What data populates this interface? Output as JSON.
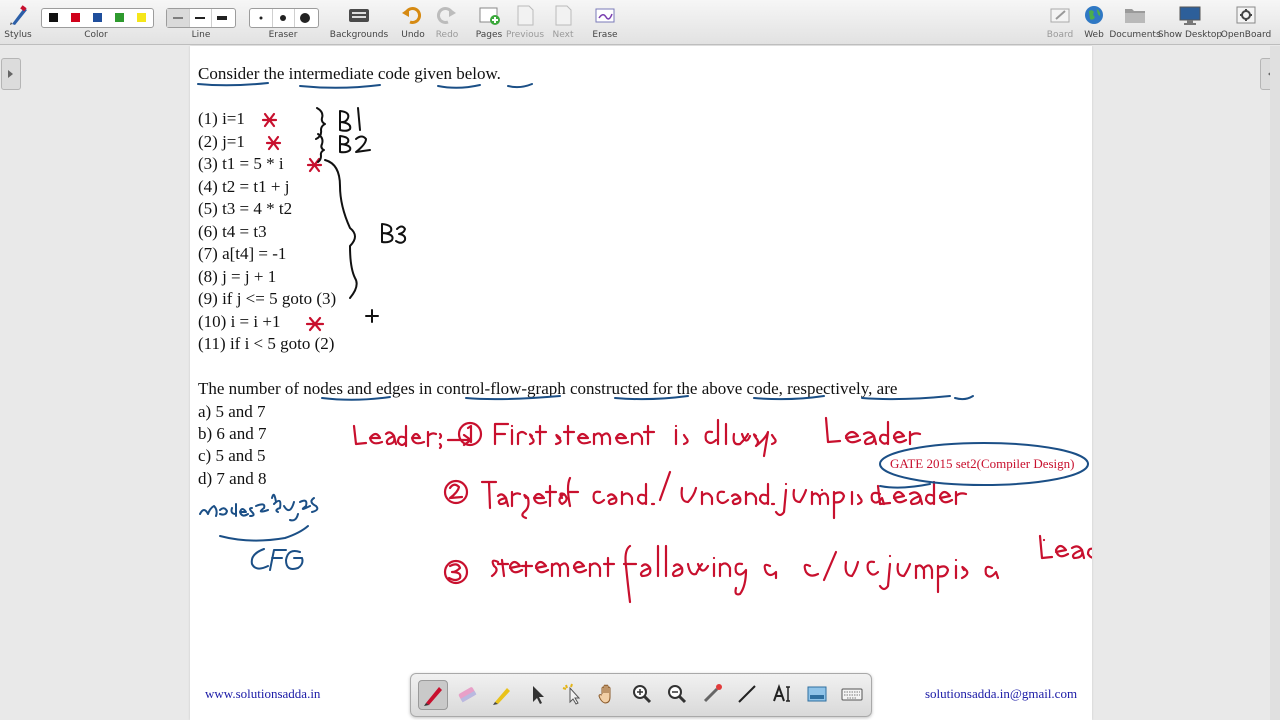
{
  "toolbar": {
    "stylus": "Stylus",
    "color": "Color",
    "line": "Line",
    "eraser": "Eraser",
    "backgrounds": "Backgrounds",
    "undo": "Undo",
    "redo": "Redo",
    "pages": "Pages",
    "previous": "Previous",
    "next": "Next",
    "erase": "Erase",
    "board": "Board",
    "web": "Web",
    "documents": "Documents",
    "show_desktop": "Show Desktop",
    "openboard": "OpenBoard"
  },
  "colors": {
    "swatches": [
      "#111111",
      "#d0021b",
      "#1f4e9c",
      "#2e9a2e",
      "#f5e61a"
    ],
    "ink_red": "#c8102e",
    "ink_blue": "#1b4f86",
    "link_blue": "#1a1aa6"
  },
  "question": {
    "intro": "Consider the intermediate code given below.",
    "code": [
      "(1) i=1",
      "(2) j=1",
      "(3) t1 = 5 * i",
      "(4) t2 = t1 + j",
      "(5) t3 = 4 * t2",
      "(6) t4 = t3",
      "(7) a[t4] = -1",
      "(8) j = j + 1",
      "(9) if j <= 5 goto (3)",
      "(10) i = i +1",
      "(11) if i < 5 goto (2)"
    ],
    "prompt": "The number of nodes and edges in control-flow-graph constructed for the above code, respectively, are",
    "options": [
      "a) 5 and 7",
      "b) 6 and 7",
      "c) 5 and 5",
      "d) 7 and 8"
    ]
  },
  "annotations": {
    "gate_tag": "GATE 2015 set2(Compiler Design)"
  },
  "footer": {
    "website": "www.solutionsadda.in",
    "email": "solutionsadda.in@gmail.com"
  },
  "palette_tools": [
    "pen-icon",
    "highlighter-icon",
    "marker-icon",
    "selector-icon",
    "interactor-icon",
    "hand-icon",
    "zoom-in-icon",
    "zoom-out-icon",
    "laser-icon",
    "line-icon",
    "text-icon",
    "capture-icon",
    "keyboard-icon"
  ]
}
